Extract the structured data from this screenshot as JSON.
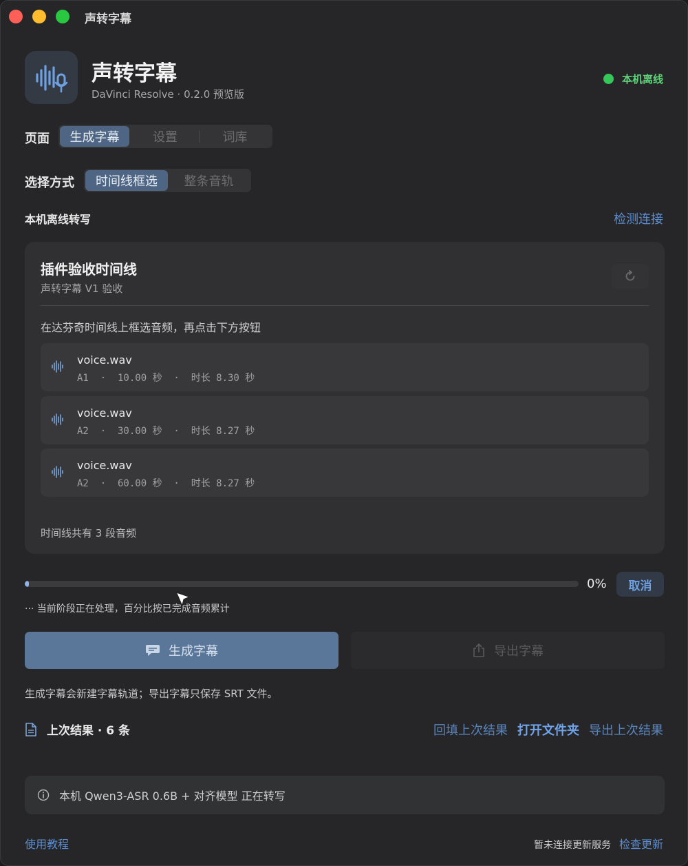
{
  "window": {
    "title": "声转字幕"
  },
  "header": {
    "app_name": "声转字幕",
    "subtitle": "DaVinci Resolve · 0.2.0 预览版",
    "status_text": "本机离线",
    "status_color": "#35c759"
  },
  "page_tabs": {
    "label": "页面",
    "items": [
      {
        "label": "生成字幕",
        "active": true
      },
      {
        "label": "设置",
        "active": false
      },
      {
        "label": "词库",
        "active": false
      }
    ]
  },
  "select_mode": {
    "label": "选择方式",
    "items": [
      {
        "label": "时间线框选",
        "active": true
      },
      {
        "label": "整条音轨",
        "active": false
      }
    ]
  },
  "section": {
    "label": "本机离线转写",
    "detect_link": "检测连接"
  },
  "card": {
    "title": "插件验收时间线",
    "subtitle": "声转字幕 V1 验收",
    "hint": "在达芬奇时间线上框选音频，再点击下方按钮",
    "clips": [
      {
        "name": "voice.wav",
        "meta": "A1  ·  10.00 秒  ·  时长 8.30 秒"
      },
      {
        "name": "voice.wav",
        "meta": "A2  ·  30.00 秒  ·  时长 8.27 秒"
      },
      {
        "name": "voice.wav",
        "meta": "A2  ·  60.00 秒  ·  时长 8.27 秒"
      }
    ],
    "footer": "时间线共有 3 段音频"
  },
  "progress": {
    "value": 0,
    "percent_text": "0%",
    "cancel_label": "取消",
    "note": "···  当前阶段正在处理，百分比按已完成音频累计"
  },
  "actions": {
    "generate_label": "生成字幕",
    "export_label": "导出字幕",
    "note": "生成字幕会新建字幕轨道；导出字幕只保存 SRT 文件。"
  },
  "last_result": {
    "text": "上次结果 · 6 条",
    "links": [
      "回填上次结果",
      "打开文件夹",
      "导出上次结果"
    ]
  },
  "info": {
    "text": "本机 Qwen3-ASR 0.6B + 对齐模型 正在转写"
  },
  "footer": {
    "tutorial": "使用教程",
    "update_status": "暂未连接更新服务",
    "check_update": "检查更新"
  },
  "icons": {
    "app": "waveform-mic-icon",
    "clip": "waveform-icon",
    "refresh": "refresh-icon",
    "generate": "chat-bubble-icon",
    "export": "share-icon",
    "document": "document-icon",
    "info": "info-icon"
  }
}
